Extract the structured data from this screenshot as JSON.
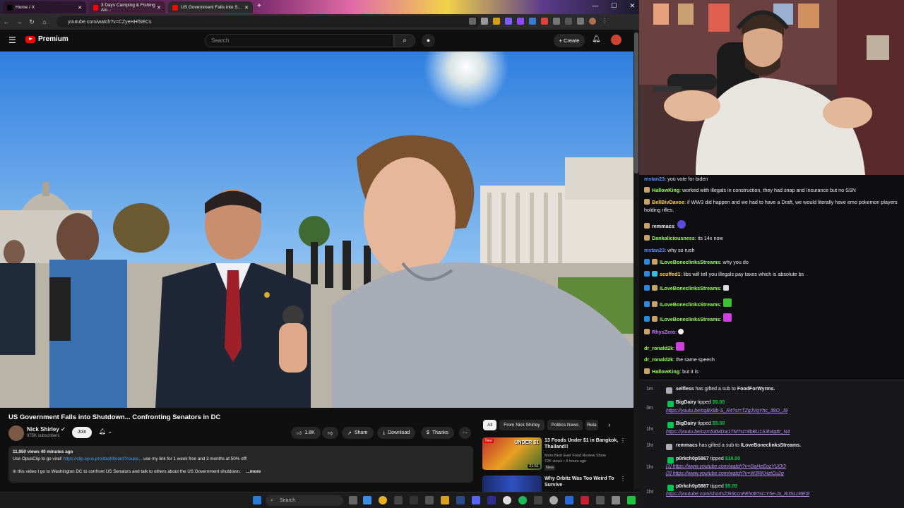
{
  "browser": {
    "tabs": [
      {
        "label": "Home / X"
      },
      {
        "label": "3 Days Camping & Fishing Alo..."
      },
      {
        "label": "US Government Falls into S..."
      }
    ],
    "url": "youtube.com/watch?v=CZyeHHfSECs"
  },
  "youtube": {
    "logo_text": "Premium",
    "search_placeholder": "Search",
    "create_label": "Create",
    "video_title": "US Government Falls into Shutdown... Confronting Senators in DC",
    "channel_name": "Nick Shirley",
    "subscribers": "975K subscribers",
    "join_label": "Join",
    "likes": "1.8K",
    "share_label": "Share",
    "download_label": "Download",
    "thanks_label": "Thanks",
    "description": {
      "stats": "11,950 views  40 minutes ago",
      "line1_pre": "Use OpusClip to go viral! ",
      "line1_link": "https://clip.opus.pro/dashboard?coupo...",
      "line1_post": " use my link for 1 week free and 3 months at 50% off!",
      "line2": "In this video I go to Washington DC to confront US Senators and talk to others about the US Government shutdown.",
      "more": "...more"
    },
    "chips": [
      "All",
      "From Nick Shirley",
      "Politics News",
      "Rela"
    ],
    "recommendations": [
      {
        "title": "13 Foods Under $1 in Bangkok, Thailand!!",
        "channel": "More Best Ever Food Review Show",
        "meta": "72K views • 4 hours ago",
        "badge": "New",
        "duration": "21:51"
      },
      {
        "title": "Why Orbitz Was Too Weird To Survive",
        "channel": "",
        "meta": "",
        "badge": "",
        "duration": ""
      }
    ]
  },
  "taskbar": {
    "search_placeholder": "Search"
  },
  "chat": [
    {
      "user": "mstan23",
      "color": "#5b8cff",
      "text": "you vote for biden"
    },
    {
      "user": "HallowKing",
      "color": "#9aff57",
      "text": "worked with illegals in construction, they had snap and Insurance but no SSN"
    },
    {
      "user": "BellBivDavoe",
      "color": "#ffd23d",
      "text": "if WW3 did happen and we had to have a Draft, we would literally have emo pokemon players holding rifles."
    },
    {
      "user": "remmacs",
      "color": "#efeff1",
      "text": ""
    },
    {
      "user": "Dankaliciousness",
      "color": "#9aff57",
      "text": "its 14x now"
    },
    {
      "user": "mstan23",
      "color": "#5b8cff",
      "text": "why so rush"
    },
    {
      "user": "ILoveBoneclinksStreams",
      "color": "#9aff57",
      "text": "why you do"
    },
    {
      "user": "scuffed1",
      "color": "#ffd23d",
      "text": "libs will tell you illegals pay taxes which is absolute bs"
    },
    {
      "user": "ILoveBoneclinksStreams",
      "color": "#9aff57",
      "text": ""
    },
    {
      "user": "ILoveBoneclinksStreams",
      "color": "#9aff57",
      "text": ""
    },
    {
      "user": "ILoveBoneclinksStreams",
      "color": "#9aff57",
      "text": ""
    },
    {
      "user": "RhysZero",
      "color": "#c77dff",
      "text": ""
    },
    {
      "user": "dr_ronald2k",
      "color": "#9aff57",
      "text": ""
    },
    {
      "user": "dr_ronald2k",
      "color": "#9aff57",
      "text": "the same speech"
    },
    {
      "user": "HallowKing",
      "color": "#9aff57",
      "text": "but it is"
    }
  ],
  "events": [
    {
      "time": "1m",
      "user": "selfless",
      "action": "has gifted a sub to",
      "target": "FoodForWyrms.",
      "links": []
    },
    {
      "time": "3m",
      "user": "BigDairy",
      "action": "tipped",
      "amount": "$5.00",
      "links": [
        "https://youtu.be/cqBX8b-S_R4?si=TZgJVqYhc_38O_J9"
      ]
    },
    {
      "time": "1hr",
      "user": "BigDairy",
      "action": "tipped",
      "amount": "$5.00",
      "links": [
        "https://youtu.be/ozmS8MDw1TM?si=9bBU1S3h4gttr_N4"
      ]
    },
    {
      "time": "1hr",
      "user": "remmacs",
      "action": "has gifted a sub to",
      "target": "ILoveBoneclinksStreams.",
      "links": []
    },
    {
      "time": "1hr",
      "user": "p0rkch0p5867",
      "action": "tipped",
      "amount": "$10.00",
      "links": [
        "[1] https://www.youtube.com/watch?v=DaHeEozYUOO",
        "[2] https://www.youtube.com/watch?v=W3RKHztCu2g"
      ]
    },
    {
      "time": "1hr",
      "user": "p0rkch0p5867",
      "action": "tipped",
      "amount": "$5.00",
      "links": [
        "https://youtube.com/shorts/Ok9ccnFEh08?si=Y5e-Jx_RJSLcRE0l"
      ]
    }
  ]
}
